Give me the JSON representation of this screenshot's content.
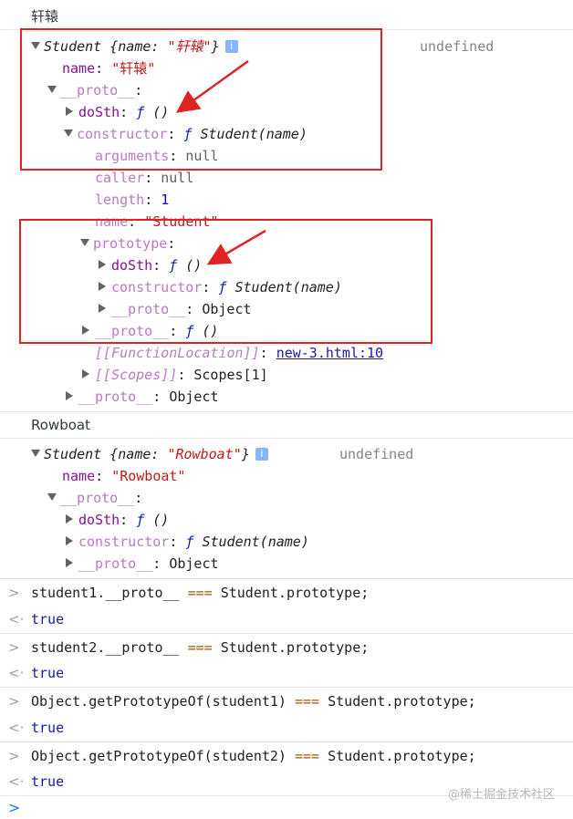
{
  "log1": "轩辕",
  "obj1": {
    "head_class": "Student",
    "head_key": "name",
    "head_val": "\"轩辕\"",
    "undefined": "undefined",
    "name_key": "name",
    "name_val": "\"轩辕\"",
    "proto": "__proto__",
    "dosth": "doSth",
    "f": "ƒ",
    "paren": "()",
    "constructor": "constructor",
    "student_fn": "Student(name)",
    "arguments": "arguments",
    "null": "null",
    "caller": "caller",
    "length": "length",
    "one": "1",
    "name2": "name",
    "student_str": "\"Student\"",
    "prototype": "prototype",
    "object": "Object",
    "fnloc": "[[FunctionLocation]]",
    "fnloc_val": "new-3.html:10",
    "scopes": "[[Scopes]]",
    "scopes_val": "Scopes[1]"
  },
  "log2": "Rowboat",
  "obj2": {
    "head_val": "\"Rowboat\"",
    "name_val": "\"Rowboat\""
  },
  "console": [
    {
      "lhs": "student1.__proto__",
      "op": "===",
      "rhs": "Student.prototype;",
      "result": "true"
    },
    {
      "lhs": "student2.__proto__",
      "op": "===",
      "rhs": "Student.prototype;",
      "result": "true"
    },
    {
      "lhs": "Object.getPrototypeOf(student1)",
      "op": "===",
      "rhs": "Student.prototype;",
      "result": "true"
    },
    {
      "lhs": "Object.getPrototypeOf(student2)",
      "op": "===",
      "rhs": "Student.prototype;",
      "result": "true"
    }
  ],
  "watermark": "@稀土掘金技术社区",
  "colors": {
    "highlight_box": "#e02424",
    "accent": "#1a73e8"
  }
}
